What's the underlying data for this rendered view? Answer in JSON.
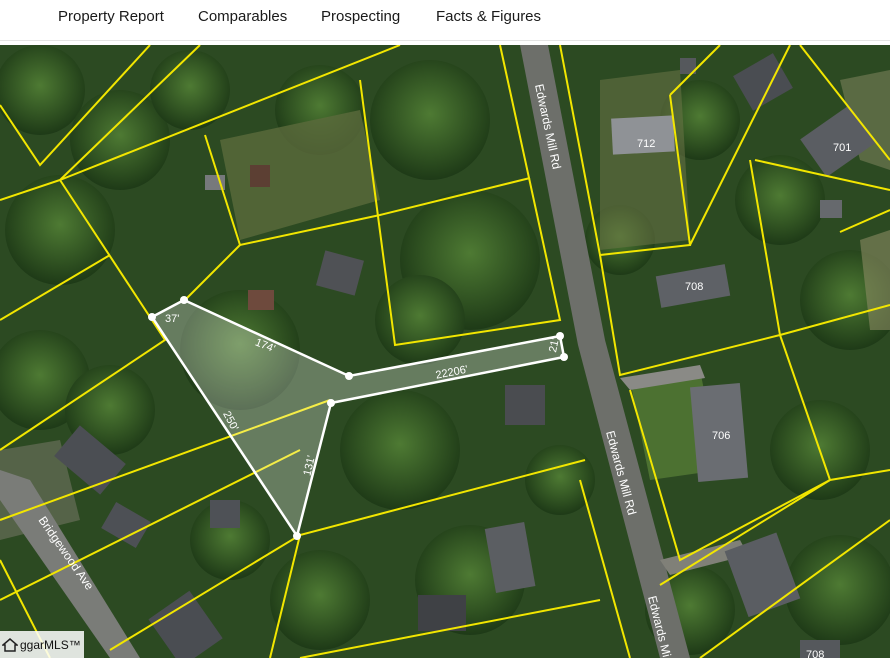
{
  "nav": {
    "items": [
      {
        "label": "Property Report"
      },
      {
        "label": "Comparables"
      },
      {
        "label": "Prospecting"
      },
      {
        "label": "Facts & Figures"
      }
    ]
  },
  "map": {
    "parcel_line_color": "#f2e600",
    "selection_color": "#ffffff",
    "road_labels": [
      "Edwards Mill Rd",
      "Edwards Mill Rd",
      "Edwards Mi",
      "Bridgewood Ave"
    ],
    "house_numbers": [
      "712",
      "701",
      "708",
      "706",
      "708"
    ],
    "dimension_labels": [
      "37'",
      "174'",
      "250'",
      "131'",
      "22206'",
      "21'"
    ]
  },
  "logo": {
    "text": "ggarMLS™"
  }
}
